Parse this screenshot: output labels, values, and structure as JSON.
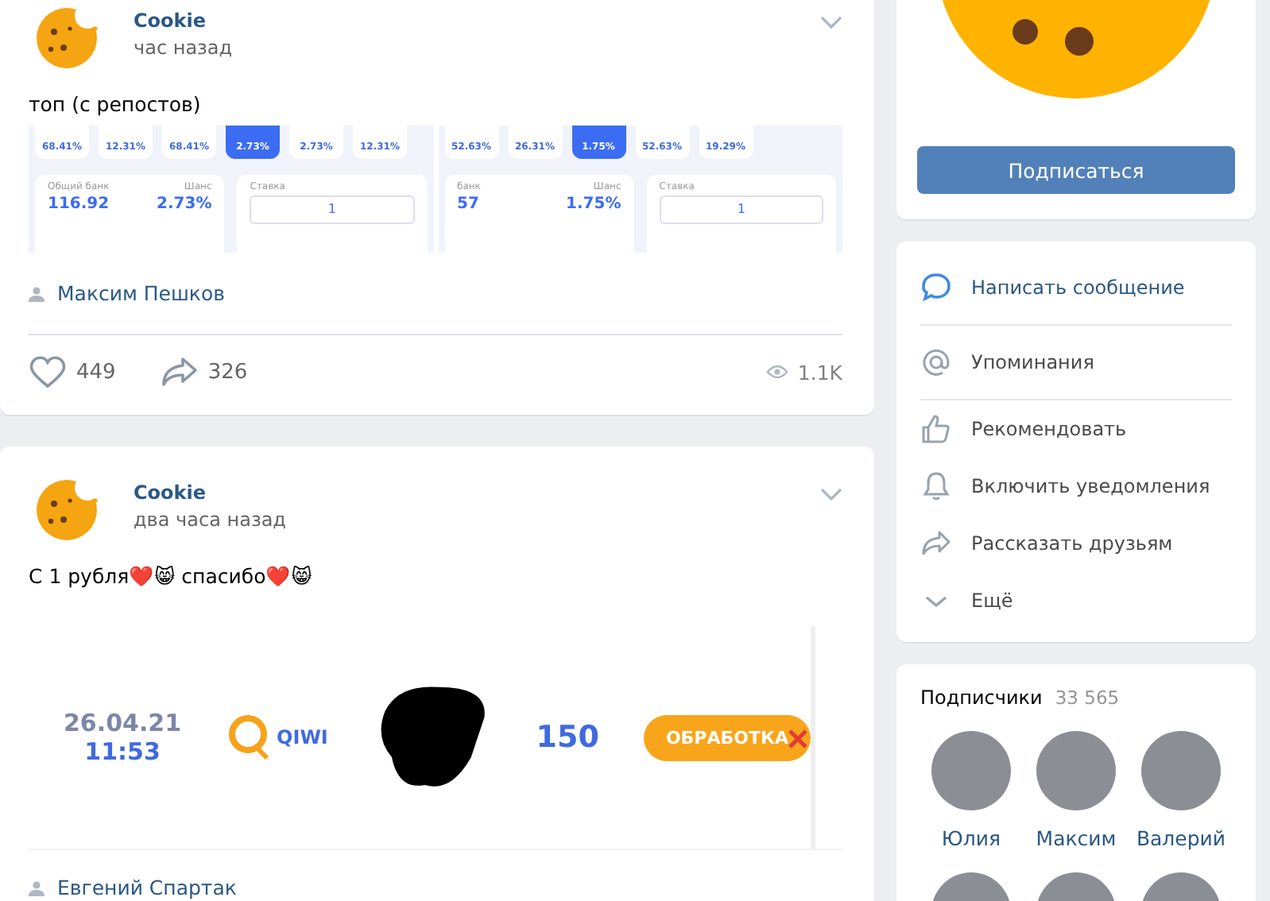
{
  "posts": [
    {
      "author": "Cookie",
      "time": "час назад",
      "text": "топ (с репостов)",
      "attachment": {
        "kind": "game",
        "panels": [
          {
            "tiles": [
              {
                "label": "68.41%",
                "selected": false
              },
              {
                "label": "12.31%",
                "selected": false
              },
              {
                "label": "68.41%",
                "selected": false
              },
              {
                "label": "2.73%",
                "selected": true
              },
              {
                "label": "2.73%",
                "selected": false
              },
              {
                "label": "12.31%",
                "selected": false
              }
            ],
            "bank_label": "Общий банк",
            "bank": "116.92",
            "chance_label": "Шанс",
            "chance": "2.73%",
            "bet_label": "Ставка",
            "bet": "1"
          },
          {
            "tiles": [
              {
                "label": "52.63%",
                "selected": false
              },
              {
                "label": "26.31%",
                "selected": false
              },
              {
                "label": "1.75%",
                "selected": true
              },
              {
                "label": "52.63%",
                "selected": false
              },
              {
                "label": "19.29%",
                "selected": false
              }
            ],
            "bank_label": "банк",
            "bank": "57",
            "chance_label": "Шанс",
            "chance": "1.75%",
            "bet_label": "Ставка",
            "bet": "1"
          }
        ]
      },
      "signer": "Максим Пешков",
      "likes": "449",
      "shares": "326",
      "views": "1.1K"
    },
    {
      "author": "Cookie",
      "time": "два часа назад",
      "text": "С 1 рубля❤️😸 спасибо❤️😸",
      "attachment": {
        "kind": "payment",
        "date": "26.04.21",
        "clock": "11:53",
        "wallet": "QIWI",
        "amount": "150",
        "status": "ОБРАБОТКА"
      },
      "signer": "Евгений Спартак"
    }
  ],
  "subscribe_button": "Подписаться",
  "menu": [
    {
      "label": "Написать сообщение",
      "kind": "message"
    },
    {
      "label": "Упоминания",
      "kind": "mention"
    },
    {
      "label": "Рекомендовать",
      "kind": "like"
    },
    {
      "label": "Включить уведомления",
      "kind": "bell"
    },
    {
      "label": "Рассказать друзьям",
      "kind": "share"
    },
    {
      "label": "Ещё",
      "kind": "more"
    }
  ],
  "subscribers": {
    "title": "Подписчики",
    "count": "33 565",
    "people": [
      "Юлия",
      "Максим",
      "Валерий"
    ]
  }
}
